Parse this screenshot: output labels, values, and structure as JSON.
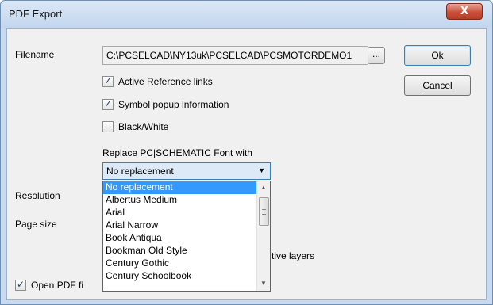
{
  "window": {
    "title": "PDF Export",
    "close_glyph": "X"
  },
  "labels": {
    "filename": "Filename",
    "resolution": "Resolution",
    "page_size": "Page size"
  },
  "filename": {
    "value": "C:\\PCSELCAD\\NY13uk\\PCSELCAD\\PCSMOTORDEMO1",
    "browse_label": "..."
  },
  "buttons": {
    "ok": "Ok",
    "cancel": "Cancel"
  },
  "options": [
    {
      "label": "Active Reference links",
      "checked": true
    },
    {
      "label": "Symbol popup information",
      "checked": true
    },
    {
      "label": "Black/White",
      "checked": false
    }
  ],
  "font_replace": {
    "label": "Replace PC|SCHEMATIC Font with",
    "selected": "No replacement",
    "items": [
      "No replacement",
      "Albertus Medium",
      "Arial",
      "Arial Narrow",
      "Book Antiqua",
      "Bookman Old Style",
      "Century Gothic",
      "Century Schoolbook"
    ],
    "highlighted_index": 0
  },
  "hidden_partial": {
    "layers_tail": "tive layers",
    "open_pdf_label": "Open PDF fi"
  },
  "open_pdf": {
    "checked": true
  },
  "check_glyph": "✓",
  "icons": {
    "combo_arrow": "chevron-down-icon",
    "scroll_up": "scroll-up-icon",
    "scroll_down": "scroll-down-icon"
  },
  "colors": {
    "selection": "#3399ff",
    "close_button": "#c9513c",
    "frame": "#c9daf0"
  }
}
